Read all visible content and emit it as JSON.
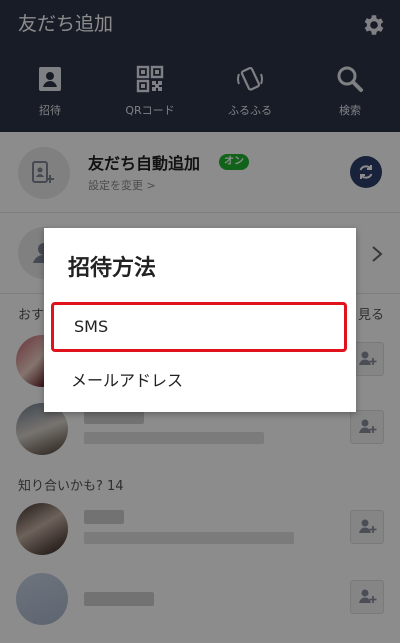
{
  "header": {
    "title": "友だち追加",
    "nav": [
      {
        "label": "招待",
        "icon": "contact-card-icon"
      },
      {
        "label": "QRコード",
        "icon": "qr-code-icon"
      },
      {
        "label": "ふるふる",
        "icon": "shake-phone-icon"
      },
      {
        "label": "検索",
        "icon": "search-icon"
      }
    ]
  },
  "auto_add": {
    "title": "友だち自動追加",
    "badge": "オン",
    "subtitle": "設定を変更 >"
  },
  "sections": {
    "recommended_prefix": "おす",
    "see_more": "見る",
    "might_know": "知り合いかも? 14"
  },
  "dialog": {
    "title": "招待方法",
    "options": [
      "SMS",
      "メールアドレス"
    ]
  },
  "colors": {
    "header_bg": "#2c3447",
    "badge_green": "#1fb52f",
    "highlight_red": "#e0131d"
  }
}
